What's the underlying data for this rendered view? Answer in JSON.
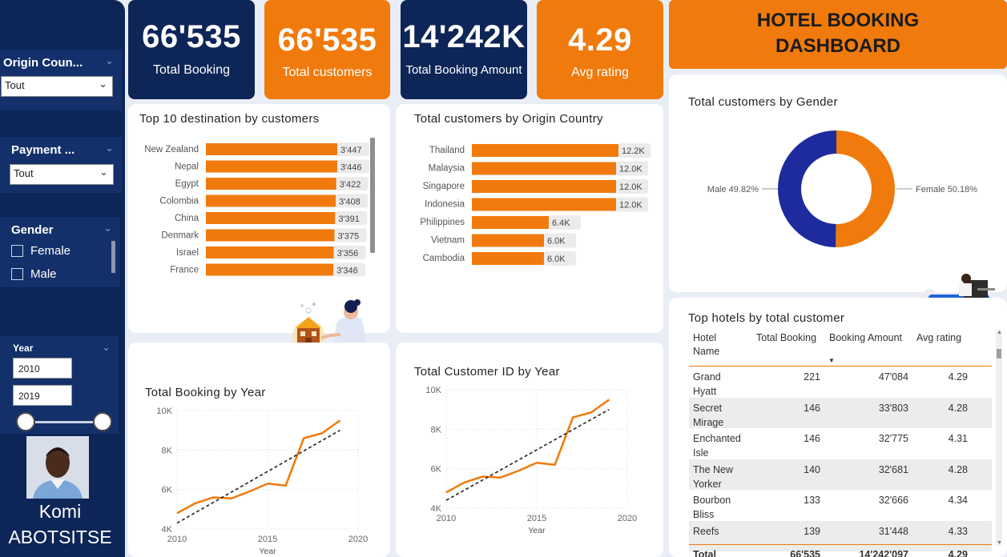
{
  "filters": {
    "origin_country": {
      "title": "Origin Coun...",
      "value": "Tout"
    },
    "payment": {
      "title": "Payment ...",
      "value": "Tout"
    },
    "gender": {
      "title": "Gender",
      "options": [
        "Female",
        "Male"
      ]
    },
    "year": {
      "title": "Year",
      "from": "2010",
      "to": "2019"
    }
  },
  "person": {
    "first_name": "Komi",
    "last_name": "ABOTSITSE"
  },
  "kpis": [
    {
      "value": "66'535",
      "label": "Total Booking"
    },
    {
      "value": "66'535",
      "label": "Total customers"
    },
    {
      "value": "14'242K",
      "label": "Total Booking Amount"
    },
    {
      "value": "4.29",
      "label": "Avg rating"
    }
  ],
  "dashboard_title": {
    "line1": "HOTEL BOOKING",
    "line2": "DASHBOARD"
  },
  "colors": {
    "navy": "#0d2557",
    "orange": "#f07a0c",
    "male_blue": "#1e2b9c",
    "trend": "#222222"
  },
  "chart_data": [
    {
      "type": "bar",
      "orientation": "horizontal",
      "title": "Top 10 destination by customers",
      "categories": [
        "New Zealand",
        "Nepal",
        "Egypt",
        "Colombia",
        "China",
        "Denmark",
        "Israel",
        "France"
      ],
      "values": [
        3447,
        3446,
        3422,
        3408,
        3391,
        3375,
        3356,
        3346
      ],
      "labels": [
        "3'447",
        "3'446",
        "3'422",
        "3'408",
        "3'391",
        "3'375",
        "3'356",
        "3'346"
      ]
    },
    {
      "type": "bar",
      "orientation": "horizontal",
      "title": "Total customers by Origin Country",
      "categories": [
        "Thailand",
        "Malaysia",
        "Singapore",
        "Indonesia",
        "Philippines",
        "Vietnam",
        "Cambodia"
      ],
      "values": [
        12200,
        12000,
        12000,
        12000,
        6400,
        6000,
        6000
      ],
      "labels": [
        "12.2K",
        "12.0K",
        "12.0K",
        "12.0K",
        "6.4K",
        "6.0K",
        "6.0K"
      ]
    },
    {
      "type": "pie",
      "title": "Total customers by Gender",
      "categories": [
        "Male",
        "Female"
      ],
      "values": [
        49.82,
        50.18
      ],
      "labels": [
        "Male 49.82%",
        "Female 50.18%"
      ]
    },
    {
      "type": "line",
      "title": "Total Booking by Year",
      "x": [
        2010,
        2011,
        2012,
        2013,
        2014,
        2015,
        2016,
        2017,
        2018,
        2019
      ],
      "values": [
        4800,
        5300,
        5600,
        5550,
        5900,
        6300,
        6200,
        8600,
        8850,
        9500
      ],
      "trend": [
        4300,
        9000
      ],
      "xlabel": "Year",
      "xticks": [
        "2010",
        "2015",
        "2020"
      ],
      "yticks": [
        "4K",
        "6K",
        "8K",
        "10K"
      ],
      "xlim": [
        2010,
        2020
      ],
      "ylim": [
        4000,
        10000
      ]
    },
    {
      "type": "line",
      "title": "Total Customer ID by Year",
      "x": [
        2010,
        2011,
        2012,
        2013,
        2014,
        2015,
        2016,
        2017,
        2018,
        2019
      ],
      "values": [
        4800,
        5300,
        5600,
        5550,
        5900,
        6300,
        6200,
        8600,
        8850,
        9500
      ],
      "trend": [
        4400,
        9000
      ],
      "xlabel": "Year",
      "xticks": [
        "2010",
        "2015",
        "2020"
      ],
      "yticks": [
        "4K",
        "6K",
        "8K",
        "10K"
      ],
      "xlim": [
        2010,
        2020
      ],
      "ylim": [
        4000,
        10000
      ]
    }
  ],
  "table": {
    "title": "Top hotels by total customer",
    "headers": [
      "Hotel Name",
      "Total Booking",
      "Booking Amount",
      "Avg rating"
    ],
    "rows": [
      {
        "name": "Grand Hyatt",
        "booking": "221",
        "amount": "47'084",
        "rating": "4.29"
      },
      {
        "name": "Secret Mirage",
        "booking": "146",
        "amount": "33'803",
        "rating": "4.28"
      },
      {
        "name": "Enchanted Isle",
        "booking": "146",
        "amount": "32'775",
        "rating": "4.31"
      },
      {
        "name": "The New Yorker",
        "booking": "140",
        "amount": "32'681",
        "rating": "4.28"
      },
      {
        "name": "Bourbon Bliss",
        "booking": "133",
        "amount": "32'666",
        "rating": "4.34"
      },
      {
        "name": "Reefs",
        "booking": "139",
        "amount": "31'448",
        "rating": "4.33"
      }
    ],
    "total": {
      "label": "Total",
      "booking": "66'535",
      "amount": "14'242'097",
      "rating": "4.29"
    }
  }
}
